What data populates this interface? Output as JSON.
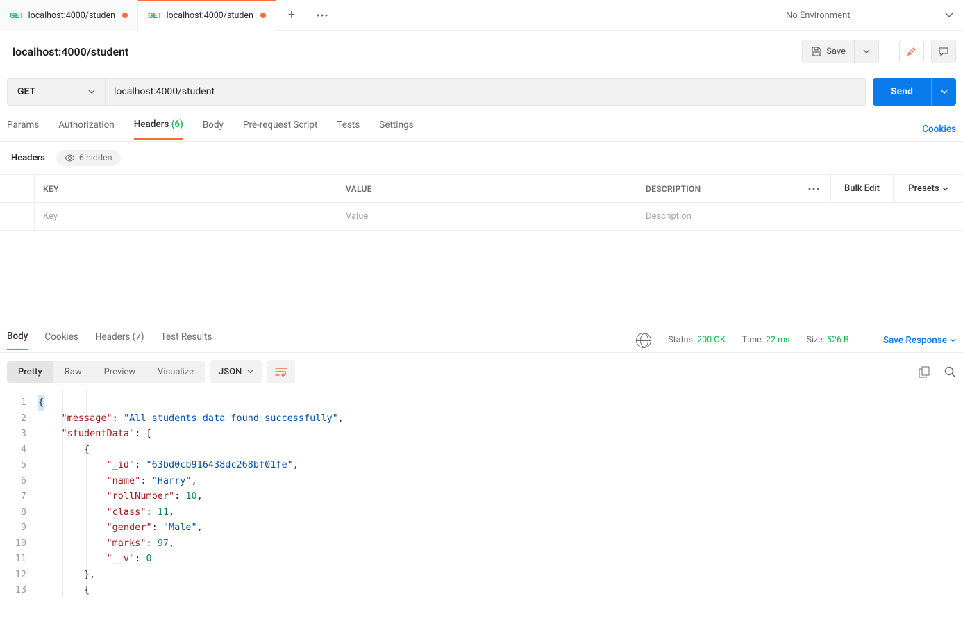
{
  "tabs": [
    {
      "method": "GET",
      "title": "localhost:4000/studen",
      "modified": true,
      "active": false
    },
    {
      "method": "GET",
      "title": "localhost:4000/studen",
      "modified": true,
      "active": true
    }
  ],
  "environment": "No Environment",
  "request": {
    "title": "localhost:4000/student",
    "save_label": "Save",
    "method": "GET",
    "url": "localhost:4000/student",
    "send_label": "Send"
  },
  "request_tabs": {
    "params": "Params",
    "authorization": "Authorization",
    "headers_label": "Headers",
    "headers_count": "(6)",
    "body": "Body",
    "prerequest": "Pre-request Script",
    "tests": "Tests",
    "settings": "Settings",
    "cookies": "Cookies"
  },
  "headers_section": {
    "title": "Headers",
    "hidden_label": "6 hidden",
    "col_key": "KEY",
    "col_value": "VALUE",
    "col_desc": "DESCRIPTION",
    "bulk_edit": "Bulk Edit",
    "presets": "Presets",
    "key_ph": "Key",
    "value_ph": "Value",
    "desc_ph": "Description"
  },
  "response_tabs": {
    "body": "Body",
    "cookies": "Cookies",
    "headers_label": "Headers",
    "headers_count": "(7)",
    "test_results": "Test Results"
  },
  "response_meta": {
    "status_label": "Status:",
    "status_value": "200 OK",
    "time_label": "Time:",
    "time_value": "22 ms",
    "size_label": "Size:",
    "size_value": "526 B",
    "save_response": "Save Response"
  },
  "response_view": {
    "pretty": "Pretty",
    "raw": "Raw",
    "preview": "Preview",
    "visualize": "Visualize",
    "format": "JSON"
  },
  "response_body": {
    "message": "All students data found successfully",
    "studentData": [
      {
        "_id": "63bd0cb916438dc268bf01fe",
        "name": "Harry",
        "rollNumber": 10,
        "class": 11,
        "gender": "Male",
        "marks": 97,
        "__v": 0
      }
    ]
  },
  "code_lines": 13
}
